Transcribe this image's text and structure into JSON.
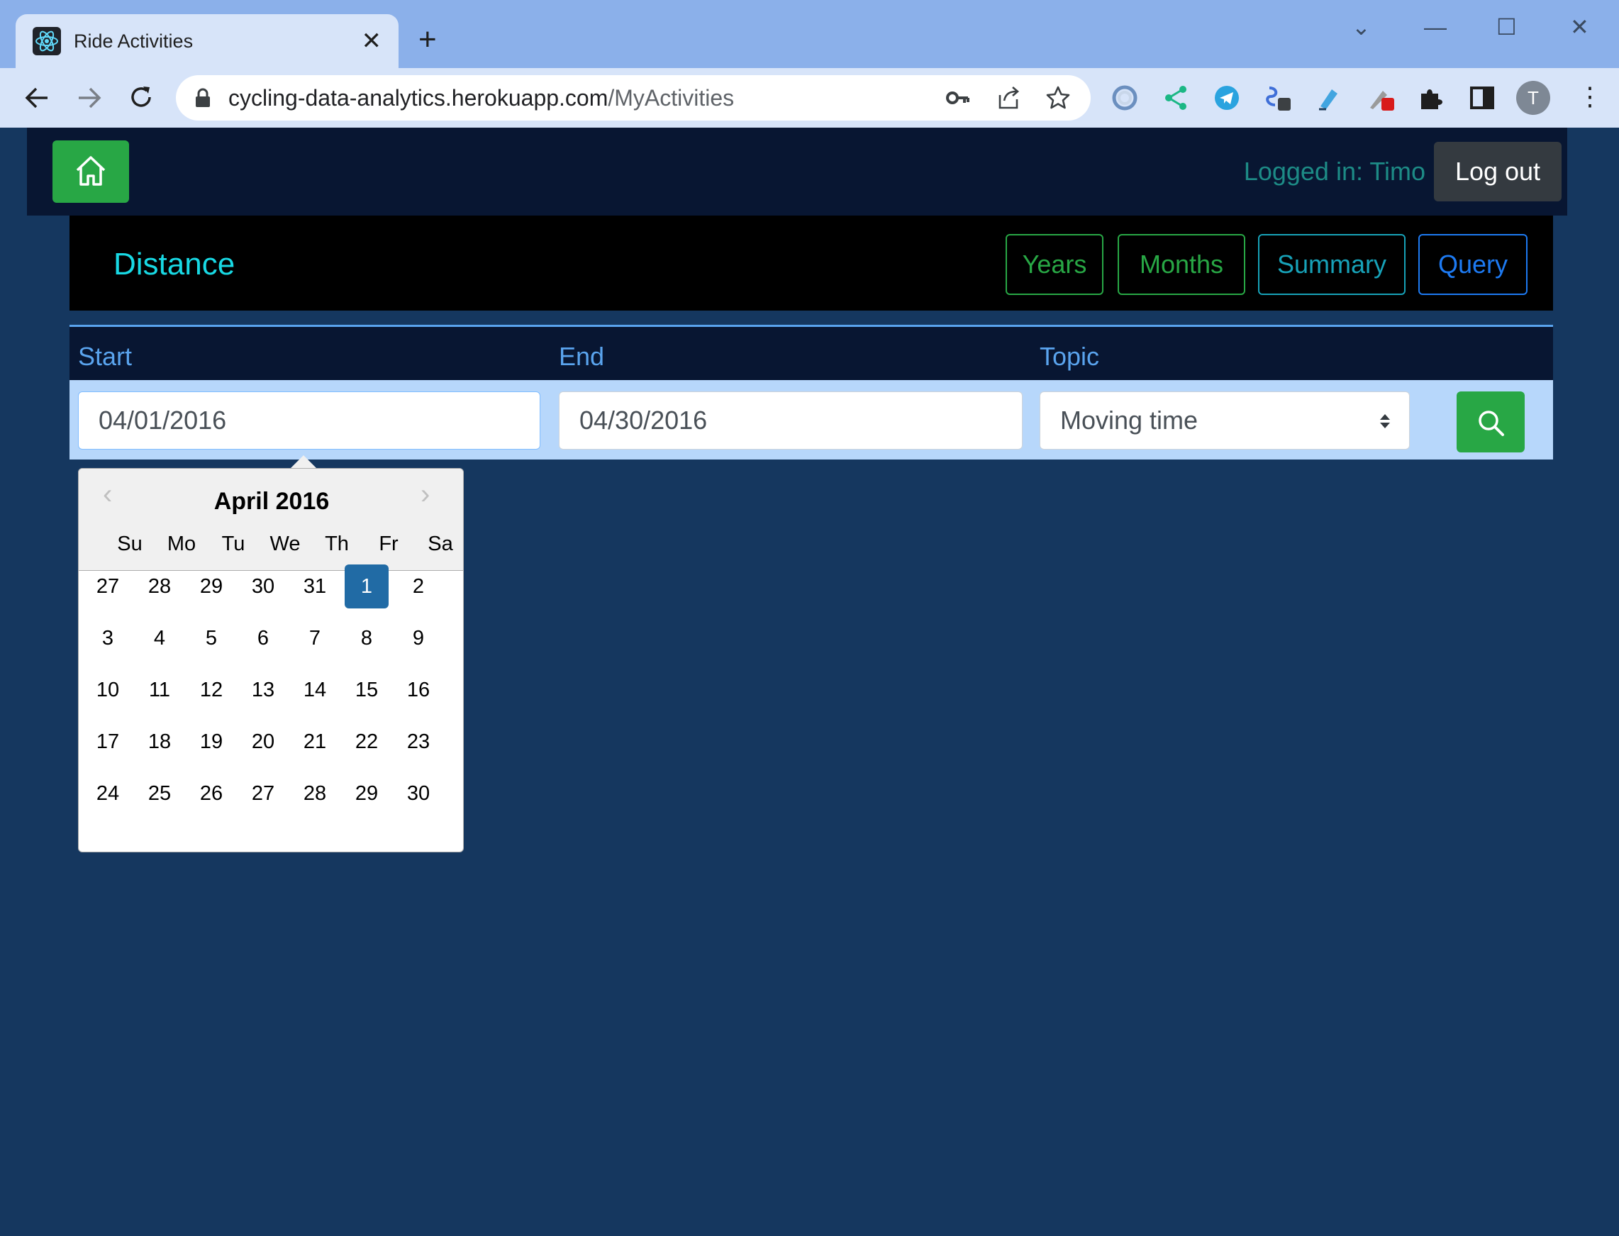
{
  "browser": {
    "tab_title": "Ride Activities",
    "tab_close": "✕",
    "new_tab": "+",
    "url_host": "cycling-data-analytics.herokuapp.com",
    "url_path": "/MyActivities",
    "profile_initial": "T",
    "window_controls": [
      "⌄",
      "—",
      "☐",
      "✕"
    ],
    "icons": [
      "back-icon",
      "forward-icon",
      "reload-icon",
      "lock-icon",
      "key-icon",
      "share-icon",
      "star-icon",
      "extensions-icon",
      "side-panel-icon",
      "menu-icon"
    ]
  },
  "navbar": {
    "logged_in": "Logged in: Timo",
    "logout_label": "Log out",
    "home_color": "#28a745"
  },
  "header": {
    "title": "Distance",
    "buttons": [
      {
        "label": "Years",
        "color": "#28a745"
      },
      {
        "label": "Months",
        "color": "#28a745"
      },
      {
        "label": "Summary",
        "color": "#17a2b8"
      },
      {
        "label": "Query",
        "color": "#007bff"
      }
    ]
  },
  "form": {
    "start_label": "Start",
    "end_label": "End",
    "topic_label": "Topic",
    "start_value": "04/01/2016",
    "end_value": "04/30/2016",
    "topic_value": "Moving time"
  },
  "datepicker": {
    "month_title": "April 2016",
    "prev": "‹",
    "next": "›",
    "weekdays": [
      "Su",
      "Mo",
      "Tu",
      "We",
      "Th",
      "Fr",
      "Sa"
    ],
    "weeks": [
      [
        "27",
        "28",
        "29",
        "30",
        "31",
        "1",
        "2"
      ],
      [
        "3",
        "4",
        "5",
        "6",
        "7",
        "8",
        "9"
      ],
      [
        "10",
        "11",
        "12",
        "13",
        "14",
        "15",
        "16"
      ],
      [
        "17",
        "18",
        "19",
        "20",
        "21",
        "22",
        "23"
      ],
      [
        "24",
        "25",
        "26",
        "27",
        "28",
        "29",
        "30"
      ]
    ],
    "selected_day": "1",
    "selected_color": "#216ba5"
  }
}
